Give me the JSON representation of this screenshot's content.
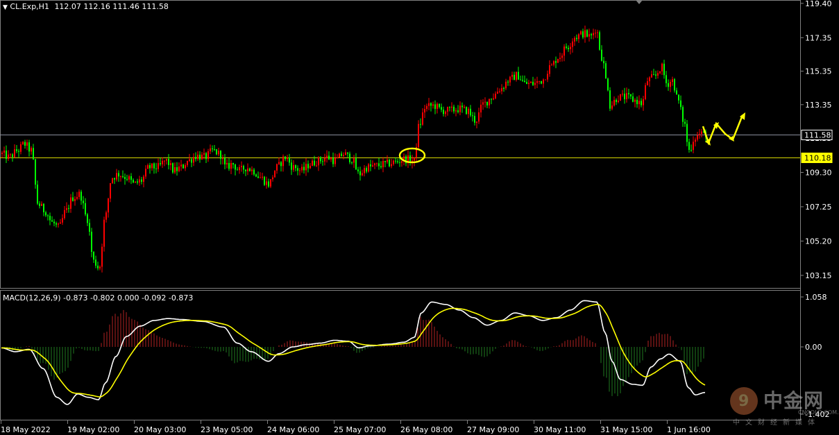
{
  "header": {
    "symbol": "CL.Exp,H1",
    "ohlc": "112.07 112.16 111.46 111.58"
  },
  "macd_header": "MACD(12,26,9) -0.873 -0.802 0.000 -0.092 -0.873",
  "price_axis": {
    "min": 102.4,
    "max": 119.6,
    "ticks": [
      "119.40",
      "117.35",
      "115.35",
      "113.35",
      "111.35",
      "109.30",
      "107.25",
      "105.20",
      "103.15"
    ],
    "tick_values": [
      119.4,
      117.35,
      115.35,
      113.35,
      111.35,
      109.3,
      107.25,
      105.2,
      103.15
    ]
  },
  "levels": {
    "current": {
      "label": "111.58",
      "value": 111.58,
      "color": "#ffffff",
      "line_color": "#8a8f9c"
    },
    "support": {
      "label": "110.18",
      "value": 110.18,
      "color": "#ffff00",
      "line_color": "#d8d800"
    }
  },
  "macd_axis": {
    "top_label": "1.058",
    "zero_label": "0.00",
    "bottom_label": "-1.402",
    "top_value": 1.058,
    "bottom_value": -1.402
  },
  "time_labels": [
    "18 May 2022",
    "19 May 02:00",
    "20 May 03:00",
    "23 May 05:00",
    "24 May 06:00",
    "25 May 07:00",
    "26 May 08:00",
    "27 May 09:00",
    "30 May 11:00",
    "31 May 15:00",
    "1 Jun 16:00"
  ],
  "colors": {
    "bull": "#ff0000",
    "bear": "#00ff00",
    "macd_line": "#ffffff",
    "signal_line": "#ffff00",
    "hist_pos": "#b22222",
    "hist_neg": "#1f7a1f",
    "annotation": "#ffff00",
    "grid": "#808080"
  },
  "chart_data": {
    "type": "candlestick",
    "price_anchors": [
      [
        0,
        110.4
      ],
      [
        10,
        110.2
      ],
      [
        22,
        110.6
      ],
      [
        32,
        111.0
      ],
      [
        42,
        110.6
      ],
      [
        52,
        107.4
      ],
      [
        62,
        107.0
      ],
      [
        72,
        106.3
      ],
      [
        82,
        106.0
      ],
      [
        92,
        107.0
      ],
      [
        102,
        107.8
      ],
      [
        112,
        108.0
      ],
      [
        122,
        106.6
      ],
      [
        132,
        104.0
      ],
      [
        140,
        103.6
      ],
      [
        148,
        106.5
      ],
      [
        158,
        109.0
      ],
      [
        168,
        109.2
      ],
      [
        180,
        109.0
      ],
      [
        190,
        108.6
      ],
      [
        200,
        108.8
      ],
      [
        212,
        109.6
      ],
      [
        224,
        109.6
      ],
      [
        236,
        110.0
      ],
      [
        248,
        109.4
      ],
      [
        258,
        109.6
      ],
      [
        268,
        110.0
      ],
      [
        280,
        110.3
      ],
      [
        292,
        110.2
      ],
      [
        304,
        110.6
      ],
      [
        314,
        110.4
      ],
      [
        322,
        109.6
      ],
      [
        332,
        109.8
      ],
      [
        342,
        109.4
      ],
      [
        352,
        109.6
      ],
      [
        362,
        109.4
      ],
      [
        372,
        109.0
      ],
      [
        384,
        108.6
      ],
      [
        396,
        109.6
      ],
      [
        408,
        110.2
      ],
      [
        420,
        109.6
      ],
      [
        432,
        109.4
      ],
      [
        444,
        109.8
      ],
      [
        456,
        110.0
      ],
      [
        468,
        110.2
      ],
      [
        480,
        110.0
      ],
      [
        492,
        110.4
      ],
      [
        504,
        110.1
      ],
      [
        514,
        109.2
      ],
      [
        526,
        109.6
      ],
      [
        540,
        109.7
      ],
      [
        552,
        109.8
      ],
      [
        566,
        109.9
      ],
      [
        580,
        110.1
      ],
      [
        594,
        110.0
      ],
      [
        600,
        112.0
      ],
      [
        610,
        113.2
      ],
      [
        622,
        113.3
      ],
      [
        634,
        113.0
      ],
      [
        646,
        113.0
      ],
      [
        658,
        113.1
      ],
      [
        670,
        113.0
      ],
      [
        682,
        112.4
      ],
      [
        694,
        113.4
      ],
      [
        706,
        113.8
      ],
      [
        718,
        114.3
      ],
      [
        730,
        114.8
      ],
      [
        742,
        115.1
      ],
      [
        754,
        114.6
      ],
      [
        766,
        114.6
      ],
      [
        778,
        114.8
      ],
      [
        790,
        115.6
      ],
      [
        802,
        116.2
      ],
      [
        814,
        116.8
      ],
      [
        826,
        117.4
      ],
      [
        838,
        117.6
      ],
      [
        848,
        117.4
      ],
      [
        856,
        117.9
      ],
      [
        864,
        116.2
      ],
      [
        872,
        114.6
      ],
      [
        876,
        113.3
      ],
      [
        888,
        113.8
      ],
      [
        900,
        113.8
      ],
      [
        912,
        113.6
      ],
      [
        922,
        113.4
      ],
      [
        930,
        114.8
      ],
      [
        940,
        115.0
      ],
      [
        950,
        115.6
      ],
      [
        958,
        114.6
      ],
      [
        966,
        114.8
      ],
      [
        974,
        113.6
      ],
      [
        982,
        112.4
      ],
      [
        990,
        110.6
      ],
      [
        998,
        111.4
      ],
      [
        1006,
        111.6
      ],
      [
        1014,
        111.6
      ]
    ],
    "macd_anchors": [
      [
        0,
        -0.02
      ],
      [
        20,
        -0.1
      ],
      [
        40,
        -0.05
      ],
      [
        60,
        -0.45
      ],
      [
        80,
        -1.05
      ],
      [
        95,
        -1.2
      ],
      [
        110,
        -0.98
      ],
      [
        125,
        -1.05
      ],
      [
        140,
        -1.1
      ],
      [
        150,
        -0.75
      ],
      [
        165,
        -0.2
      ],
      [
        180,
        0.22
      ],
      [
        200,
        0.44
      ],
      [
        220,
        0.56
      ],
      [
        240,
        0.6
      ],
      [
        260,
        0.58
      ],
      [
        290,
        0.54
      ],
      [
        320,
        0.42
      ],
      [
        340,
        0.08
      ],
      [
        360,
        -0.1
      ],
      [
        385,
        -0.3
      ],
      [
        400,
        -0.14
      ],
      [
        420,
        0.0
      ],
      [
        440,
        0.05
      ],
      [
        460,
        0.08
      ],
      [
        480,
        0.14
      ],
      [
        500,
        0.12
      ],
      [
        515,
        -0.02
      ],
      [
        530,
        0.02
      ],
      [
        560,
        0.06
      ],
      [
        580,
        0.1
      ],
      [
        595,
        0.2
      ],
      [
        605,
        0.72
      ],
      [
        620,
        0.95
      ],
      [
        640,
        0.9
      ],
      [
        660,
        0.78
      ],
      [
        680,
        0.62
      ],
      [
        700,
        0.46
      ],
      [
        720,
        0.56
      ],
      [
        740,
        0.72
      ],
      [
        760,
        0.66
      ],
      [
        780,
        0.56
      ],
      [
        800,
        0.62
      ],
      [
        820,
        0.78
      ],
      [
        840,
        0.98
      ],
      [
        858,
        0.95
      ],
      [
        870,
        0.3
      ],
      [
        880,
        -0.3
      ],
      [
        892,
        -0.68
      ],
      [
        910,
        -0.78
      ],
      [
        924,
        -0.8
      ],
      [
        936,
        -0.42
      ],
      [
        950,
        -0.25
      ],
      [
        962,
        -0.15
      ],
      [
        978,
        -0.3
      ],
      [
        990,
        -0.85
      ],
      [
        1000,
        -1.0
      ],
      [
        1014,
        -0.95
      ]
    ]
  }
}
